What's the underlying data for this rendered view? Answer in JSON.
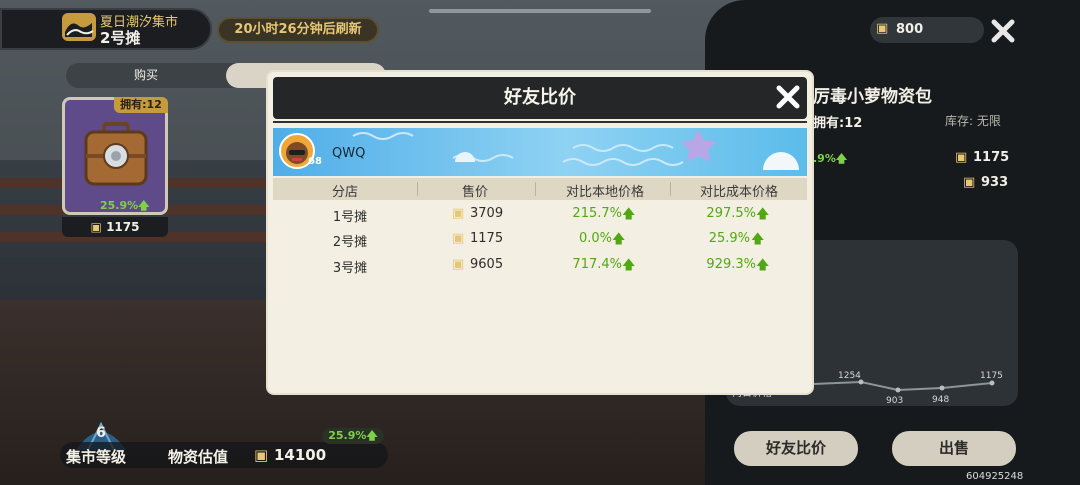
{
  "header": {
    "market_name": "夏日潮汐集市",
    "stall_name": "2号摊",
    "refresh_text": "20小时26分钟后刷新"
  },
  "tabs": {
    "buy": "购买"
  },
  "item_card": {
    "owned": "拥有:12",
    "pct": "25.9%",
    "price": "1175"
  },
  "bottom": {
    "level": "6",
    "level_label": "集市等级",
    "value_label": "物资估值",
    "value": "14100",
    "value_pct": "25.9%"
  },
  "right_panel": {
    "coins": "800",
    "title": "厉毒小萝物资包",
    "owned": "拥有:12",
    "stock": "库存: 无限",
    "pct": ".9%",
    "price1": "1175",
    "price2": "933",
    "chart": {
      "labels": [
        "1254",
        "903",
        "948",
        "1175"
      ],
      "axis_text": "两日价格"
    },
    "compare_button": "好友比价",
    "sell_button": "出售",
    "uid": "604925248"
  },
  "modal": {
    "title": "好友比价",
    "friend": {
      "name": "QWQ",
      "level": "68"
    },
    "columns": [
      "分店",
      "售价",
      "对比本地价格",
      "对比成本价格"
    ],
    "rows": [
      {
        "shop": "1号摊",
        "price": "3709",
        "local": "215.7%",
        "cost": "297.5%"
      },
      {
        "shop": "2号摊",
        "price": "1175",
        "local": "0.0%",
        "cost": "25.9%"
      },
      {
        "shop": "3号摊",
        "price": "9605",
        "local": "717.4%",
        "cost": "929.3%"
      }
    ]
  },
  "colors": {
    "accent_gold": "#e7c774",
    "up_green": "#52a812",
    "modal_bg": "#f3efe2",
    "header_dark": "#252628"
  },
  "icons": [
    "wave-icon",
    "suitcase-icon",
    "coin-icon",
    "close-icon",
    "shell-icon",
    "arrow-up-icon",
    "avatar-icon"
  ]
}
